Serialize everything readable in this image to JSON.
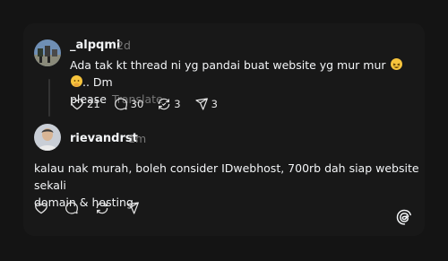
{
  "post1": {
    "username": "_alpqml",
    "time": "2d",
    "text_line1": "Ada tak kt thread ni yg pandai buat website yg mur mur",
    "emojis": [
      "grinning-squinting-face",
      "face-with-hand-over-mouth"
    ],
    "text_after_emoji": ".. Dm",
    "text_line2": "please",
    "translate_label": "Translate",
    "stats": {
      "likes": "21",
      "replies": "30",
      "reposts": "3",
      "shares": "3"
    }
  },
  "post2": {
    "username": "rievandrst",
    "time": "1m",
    "text_line1": "kalau nak murah, boleh consider IDwebhost, 700rb dah siap website sekali",
    "text_line2": "domain & hosting"
  },
  "colors": {
    "background": "#141414",
    "card": "#181818",
    "text": "#f3f5f7",
    "muted": "#777777"
  },
  "icons": [
    "heart-icon",
    "comment-icon",
    "repost-icon",
    "share-icon",
    "threads-logo-icon"
  ]
}
